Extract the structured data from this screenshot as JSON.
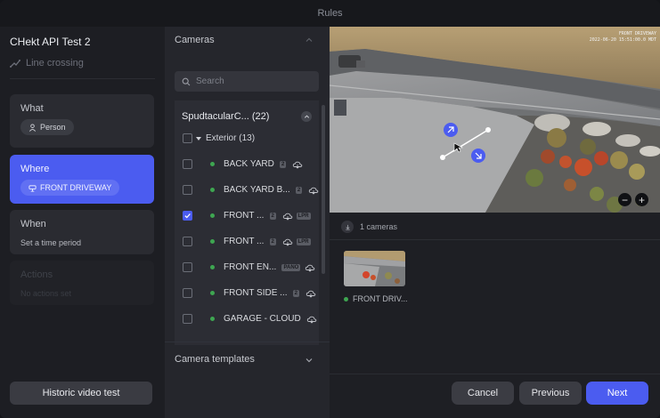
{
  "window": {
    "title": "Rules"
  },
  "rule": {
    "name": "CHekt API Test 2",
    "type_label": "Line crossing"
  },
  "steps": {
    "what": {
      "label": "What",
      "chip": "Person"
    },
    "where": {
      "label": "Where",
      "chip": "FRONT DRIVEWAY"
    },
    "when": {
      "label": "When",
      "sub": "Set a time period"
    },
    "actions": {
      "label": "Actions",
      "sub": "No actions set"
    }
  },
  "historic_button": "Historic video test",
  "cameras": {
    "header": "Cameras",
    "search_placeholder": "Search",
    "group": {
      "name": "SpudtacularC...",
      "count": "(22)"
    },
    "subgroup": {
      "name": "Exterior",
      "count": "(13)"
    },
    "items": [
      {
        "name": "BACK YARD",
        "badge": "2",
        "badge2": "",
        "checked": false
      },
      {
        "name": "BACK YARD B...",
        "badge": "2",
        "badge2": "",
        "checked": false
      },
      {
        "name": "FRONT ...",
        "badge": "2",
        "badge2": "LPR",
        "checked": true
      },
      {
        "name": "FRONT ...",
        "badge": "2",
        "badge2": "LPR",
        "checked": false
      },
      {
        "name": "FRONT EN...",
        "badge": "PANO",
        "badge2": "",
        "checked": false
      },
      {
        "name": "FRONT SIDE ...",
        "badge": "2",
        "badge2": "",
        "checked": false
      },
      {
        "name": "GARAGE - CLOUD",
        "badge": "",
        "badge2": "",
        "checked": false
      }
    ],
    "templates_label": "Camera templates"
  },
  "preview": {
    "overlay_line1": "FRONT DRIVEWAY",
    "overlay_line2": "2022-06-20 15:51:00.0 MDT",
    "selected_count": "1 cameras",
    "thumb_label": "FRONT DRIV..."
  },
  "footer": {
    "cancel": "Cancel",
    "previous": "Previous",
    "next": "Next"
  },
  "colors": {
    "accent": "#4b5cf0",
    "online": "#3ea651",
    "background": "#1b1c21"
  }
}
